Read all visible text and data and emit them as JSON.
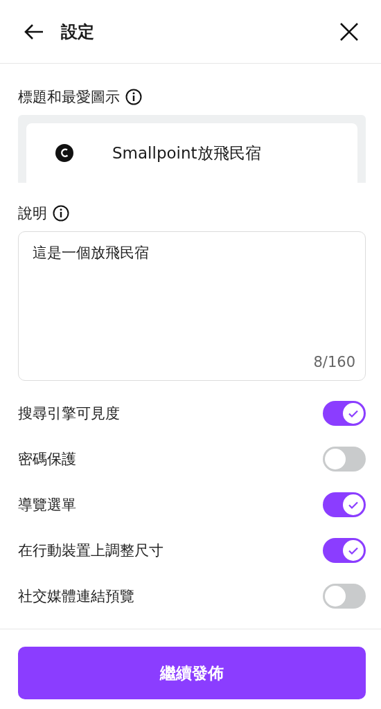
{
  "header": {
    "title": "設定"
  },
  "title_section": {
    "label": "標題和最愛圖示",
    "site_title": "Smallpoint放飛民宿"
  },
  "description_section": {
    "label": "說明",
    "value": "這是一個放飛民宿",
    "counter": "8/160"
  },
  "toggles": [
    {
      "label": "搜尋引擎可見度",
      "on": true
    },
    {
      "label": "密碼保護",
      "on": false
    },
    {
      "label": "導覽選單",
      "on": true
    },
    {
      "label": "在行動裝置上調整尺寸",
      "on": true
    },
    {
      "label": "社交媒體連結預覽",
      "on": false
    }
  ],
  "primary_button": "繼續發佈"
}
